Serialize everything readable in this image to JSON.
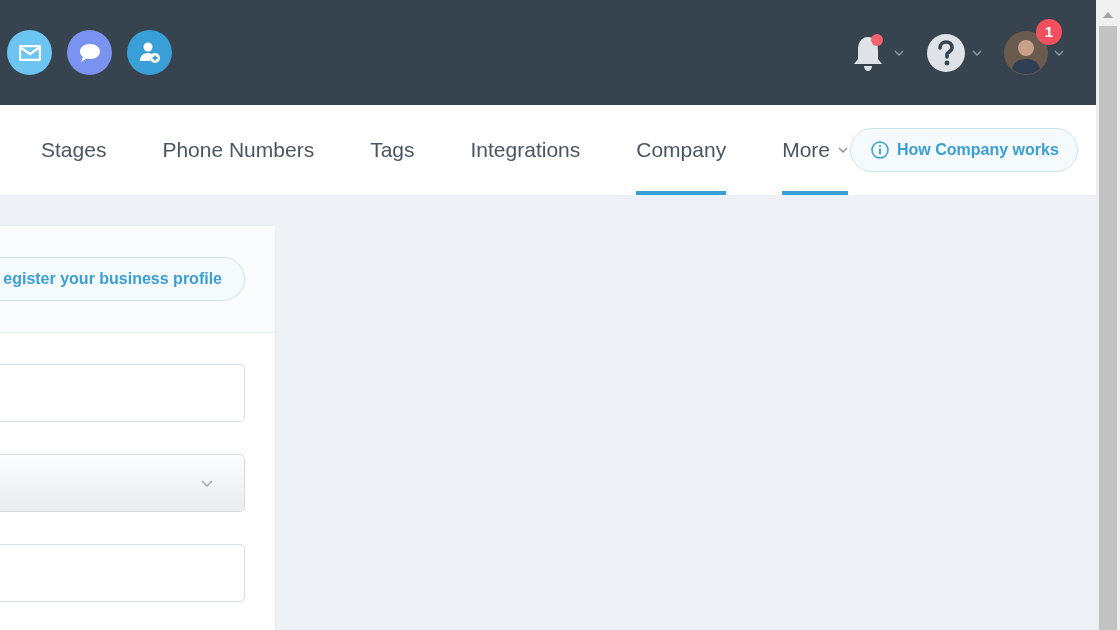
{
  "top_bar": {
    "quick_actions": [
      {
        "kind": "email",
        "color": "#6cc4f0"
      },
      {
        "kind": "chat",
        "color": "#7b93f0"
      },
      {
        "kind": "contact",
        "color": "#3a9fd6"
      }
    ],
    "notifications": {
      "unread": true
    },
    "profile": {
      "badge": "1"
    }
  },
  "tabs": [
    {
      "label": "Stages",
      "selected": false,
      "dropdown": false
    },
    {
      "label": "Phone Numbers",
      "selected": false,
      "dropdown": false
    },
    {
      "label": "Tags",
      "selected": false,
      "dropdown": false
    },
    {
      "label": "Integrations",
      "selected": false,
      "dropdown": false
    },
    {
      "label": "Company",
      "selected": true,
      "dropdown": false
    },
    {
      "label": "More",
      "selected": true,
      "dropdown": true
    }
  ],
  "help_button": {
    "label": "How Company works"
  },
  "card": {
    "register_button": {
      "label": "egister your business profile"
    },
    "fields": [
      {
        "kind": "text"
      },
      {
        "kind": "select"
      },
      {
        "kind": "text"
      }
    ]
  }
}
